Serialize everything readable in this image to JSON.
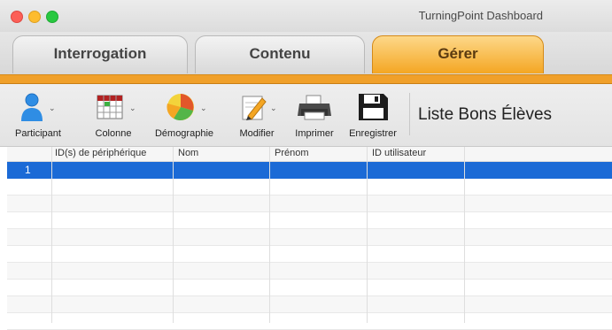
{
  "window": {
    "title": "TurningPoint Dashboard"
  },
  "tabs": [
    {
      "label": "Interrogation"
    },
    {
      "label": "Contenu"
    },
    {
      "label": "Gérer",
      "active": true
    }
  ],
  "toolbar": {
    "items": [
      {
        "label": "Participant",
        "icon": "participant-icon",
        "has_dropdown": true
      },
      {
        "label": "Colonne",
        "icon": "column-grid-icon",
        "has_dropdown": true
      },
      {
        "label": "Démographie",
        "icon": "pie-chart-icon",
        "has_dropdown": true
      },
      {
        "label": "Modifier",
        "icon": "edit-pencil-icon",
        "has_dropdown": true
      },
      {
        "label": "Imprimer",
        "icon": "printer-icon",
        "has_dropdown": false
      },
      {
        "label": "Enregistrer",
        "icon": "floppy-disk-icon",
        "has_dropdown": false
      }
    ],
    "list_name": "Liste Bons Élèves"
  },
  "table": {
    "columns": [
      "",
      "ID(s) de périphérique",
      "Nom",
      "Prénom",
      "ID utilisateur",
      ""
    ],
    "rows": [
      {
        "num": "1",
        "selected": true
      },
      {},
      {},
      {},
      {},
      {},
      {},
      {},
      {},
      {}
    ]
  },
  "colors": {
    "accent_orange": "#f0a02a",
    "selection_blue": "#1b6ad6"
  }
}
